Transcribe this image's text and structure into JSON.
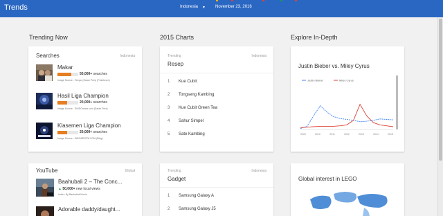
{
  "header": {
    "brand": "Trends",
    "region": "Indonesia",
    "date": "November 23, 2016",
    "accent": "#2a67c3",
    "dots": [
      "#f4b400",
      "#db4437",
      "#db4437",
      "#0f9d58",
      "#db4437"
    ]
  },
  "columns": {
    "col1": "Trending Now",
    "col2": "2015 Charts",
    "col3": "Explore In-Depth"
  },
  "searches": {
    "title": "Searches",
    "region": "Indonesia",
    "items": [
      {
        "title": "Makar",
        "count": "50,000+",
        "label": "searches",
        "source": "Image Source - Tempo (Saran Pers) (Potoforum)",
        "bar_fraction": 0.65
      },
      {
        "title": "Hasil Liga Champion",
        "count": "20,000+",
        "label": "searches",
        "source": "Image Source - SINDOnews.com (Saran Pers)",
        "bar_fraction": 0.5
      },
      {
        "title": "Klasemen Liga Champion",
        "count": "20,000+",
        "label": "searches",
        "source": "Image Source - INDOSERITA.COM (Blog)",
        "bar_fraction": 0.5
      }
    ]
  },
  "resep": {
    "small_label": "Trending",
    "region": "Indonesia",
    "title": "Resep",
    "items": [
      {
        "num": "1",
        "text": "Kue Cubit"
      },
      {
        "num": "2",
        "text": "Tongseng Kambing"
      },
      {
        "num": "3",
        "text": "Kue Cubit Green Tea"
      },
      {
        "num": "4",
        "text": "Sahur Simpel"
      },
      {
        "num": "5",
        "text": "Sate Kambing"
      }
    ]
  },
  "explore": {
    "title": "Justin Bieber vs. Miley Cyrus"
  },
  "chart_data": {
    "type": "line",
    "x": [
      "2009",
      "2010",
      "2011",
      "2012",
      "2013",
      "2014",
      "2015"
    ],
    "series": [
      {
        "name": "Justin Bieber",
        "color": "#4285f4",
        "values": [
          2,
          7,
          30,
          52,
          38,
          28,
          24,
          22,
          20,
          17,
          18,
          20,
          23,
          22,
          21
        ]
      },
      {
        "name": "Miley Cyrus",
        "color": "#db4437",
        "values": [
          4,
          5,
          6,
          7,
          7,
          7,
          8,
          10,
          20,
          55,
          30,
          15,
          10,
          8,
          6
        ]
      }
    ],
    "ylim": [
      0,
      100
    ],
    "legend": "top-left"
  },
  "youtube": {
    "title": "YouTube",
    "region": "Global",
    "items": [
      {
        "title": "Baahubali 2 – The Conc...",
        "views": "50,000+",
        "views_label": "new local views",
        "meta": "India • By Baahubali Movie"
      },
      {
        "title": "Adorable daddy/daught..."
      }
    ]
  },
  "gadget": {
    "small_label": "Trending",
    "region": "Indonesia",
    "title": "Gadget",
    "items": [
      {
        "num": "1",
        "text": "Samsung Galaxy A"
      },
      {
        "num": "2",
        "text": "Samsung Galaxy J5"
      }
    ]
  },
  "lego": {
    "title": "Global interest in LEGO"
  }
}
